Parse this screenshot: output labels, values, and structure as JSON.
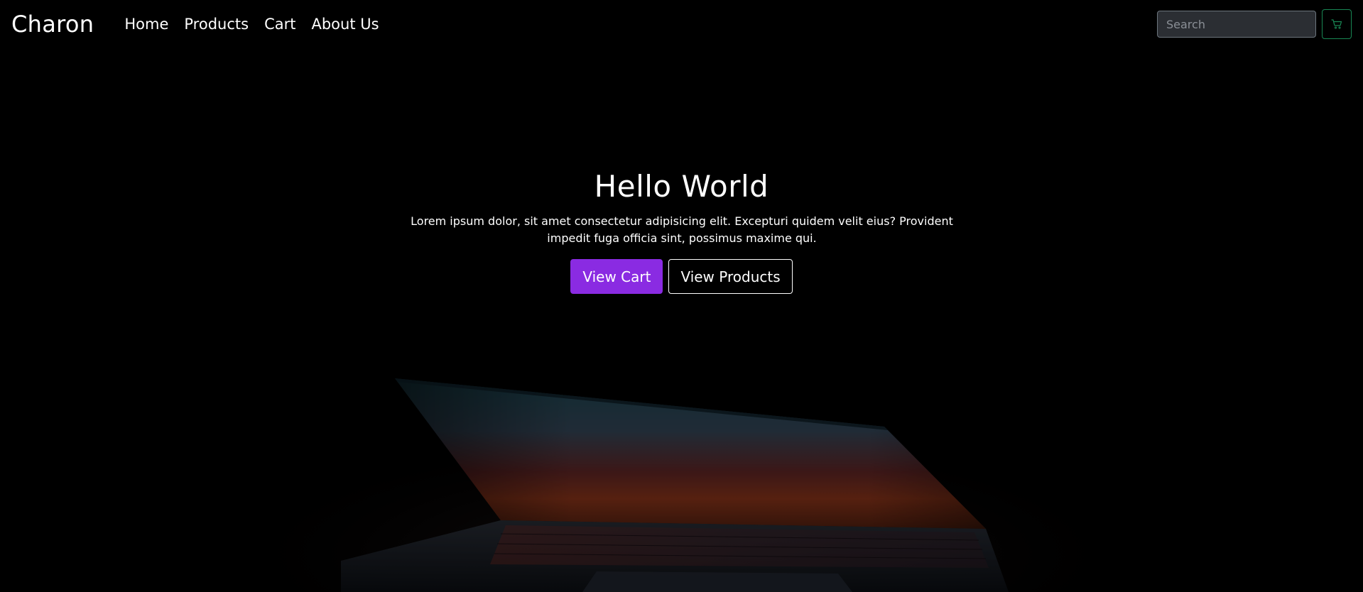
{
  "navbar": {
    "brand": "Charon",
    "links": [
      {
        "label": "Home"
      },
      {
        "label": "Products"
      },
      {
        "label": "Cart"
      },
      {
        "label": "About Us"
      }
    ],
    "search_placeholder": "Search",
    "cart_icon": "cart-icon"
  },
  "hero": {
    "title": "Hello World",
    "text": "Lorem ipsum dolor, sit amet consectetur adipisicing elit. Excepturi quidem velit eius? Provident impedit fuga officia sint, possimus maxime qui.",
    "primary_button": "View Cart",
    "secondary_button": "View Products"
  },
  "colors": {
    "background": "#000000",
    "accent_purple": "#8a2be2",
    "cart_outline_green": "#198754"
  }
}
